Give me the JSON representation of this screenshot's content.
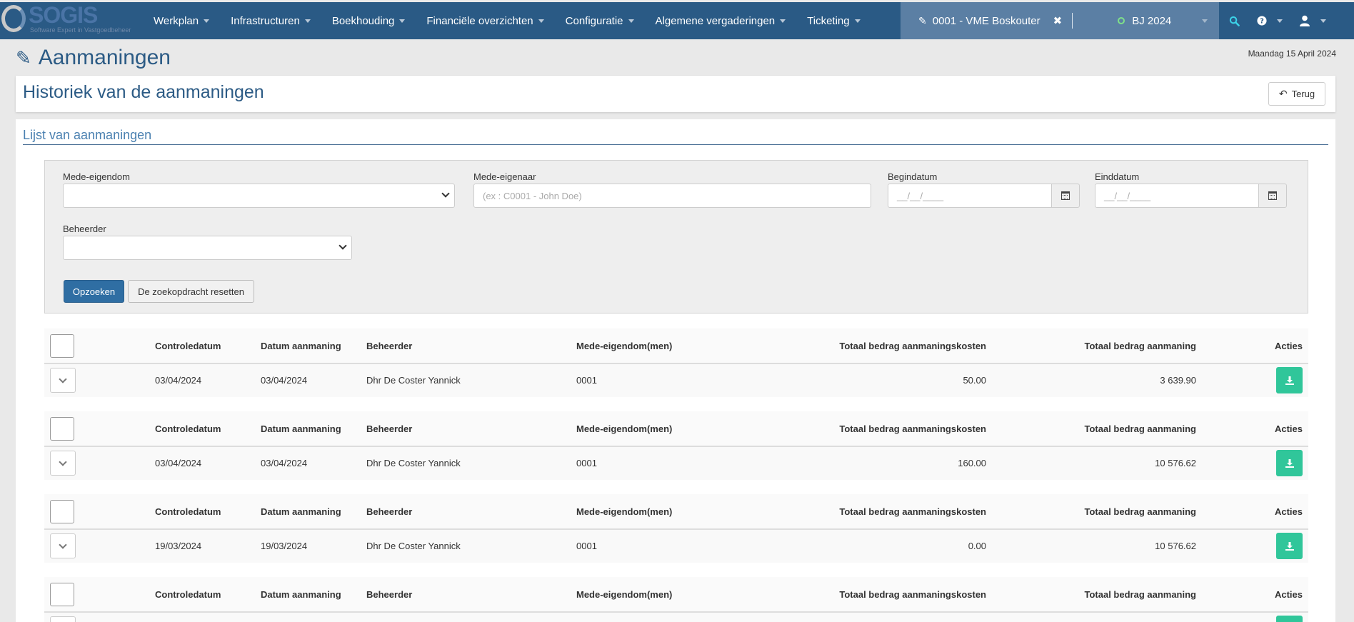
{
  "nav": {
    "logo_text": "SOGIS",
    "logo_tagline": "Software Expert in Vastgoedbeheer",
    "menu": [
      {
        "label": "Werkplan"
      },
      {
        "label": "Infrastructuren"
      },
      {
        "label": "Boekhouding"
      },
      {
        "label": "Financiële overzichten"
      },
      {
        "label": "Configuratie"
      },
      {
        "label": "Algemene vergaderingen"
      },
      {
        "label": "Ticketing"
      }
    ],
    "vme_label": "0001 - VME Boskouter",
    "year_label": "BJ 2024"
  },
  "header": {
    "page_title": "Aanmaningen",
    "date": "Maandag 15 April 2024",
    "panel_title": "Historiek van de aanmaningen",
    "back_label": "Terug"
  },
  "main": {
    "subtitle": "Lijst van aanmaningen"
  },
  "filter": {
    "mede_eigendom_label": "Mede-eigendom",
    "mede_eigenaar_label": "Mede-eigenaar",
    "mede_eigenaar_placeholder": "(ex : C0001 - John Doe)",
    "begindatum_label": "Begindatum",
    "begindatum_placeholder": "__/__/____",
    "einddatum_label": "Einddatum",
    "einddatum_placeholder": "__/__/____",
    "beheerder_label": "Beheerder",
    "search_label": "Opzoeken",
    "reset_label": "De zoekopdracht resetten"
  },
  "table": {
    "headers": {
      "controledatum": "Controledatum",
      "datum_aanmaning": "Datum aanmaning",
      "beheerder": "Beheerder",
      "mede_eigendom": "Mede-eigendom(men)",
      "totaal_kosten": "Totaal bedrag aanmaningskosten",
      "totaal": "Totaal bedrag aanmaning",
      "acties": "Acties"
    },
    "rows": [
      {
        "controledatum": "03/04/2024",
        "datum_aanmaning": "03/04/2024",
        "beheerder": "Dhr De Coster Yannick",
        "mede_eigendom": "0001",
        "totaal_kosten": "50.00",
        "totaal": "3 639.90"
      },
      {
        "controledatum": "03/04/2024",
        "datum_aanmaning": "03/04/2024",
        "beheerder": "Dhr De Coster Yannick",
        "mede_eigendom": "0001",
        "totaal_kosten": "160.00",
        "totaal": "10 576.62"
      },
      {
        "controledatum": "19/03/2024",
        "datum_aanmaning": "19/03/2024",
        "beheerder": "Dhr De Coster Yannick",
        "mede_eigendom": "0001",
        "totaal_kosten": "0.00",
        "totaal": "10 576.62"
      }
    ]
  }
}
